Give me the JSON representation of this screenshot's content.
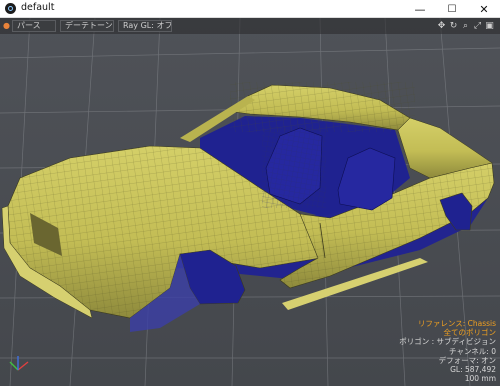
{
  "window": {
    "title": "default",
    "controls": {
      "minimize": "—",
      "maximize": "☐",
      "close": "✕"
    }
  },
  "toolbar": {
    "tabs": [
      {
        "label": "パース"
      },
      {
        "label": "デーテトーン"
      },
      {
        "label": "Ray GL: オフ"
      }
    ],
    "icons": [
      "move-icon",
      "rotate-icon",
      "zoom-icon",
      "fit-icon",
      "maximize-viewport-icon"
    ]
  },
  "info": {
    "reference": "リファレンス: Chassis",
    "polygons_all": "全てのポリゴン",
    "polygon_type": "ポリゴン : サブディビジョン",
    "channel": "チャンネル: 0",
    "deformer": "デフォーマ: オン",
    "gl_count": "GL: 587,492",
    "scale": "100 mm"
  },
  "colors": {
    "viewport_bg": "#4a4d52",
    "mesh_fill": "#c7c25a",
    "wire": "#1d1f8a",
    "warning_text": "#f0a020"
  }
}
